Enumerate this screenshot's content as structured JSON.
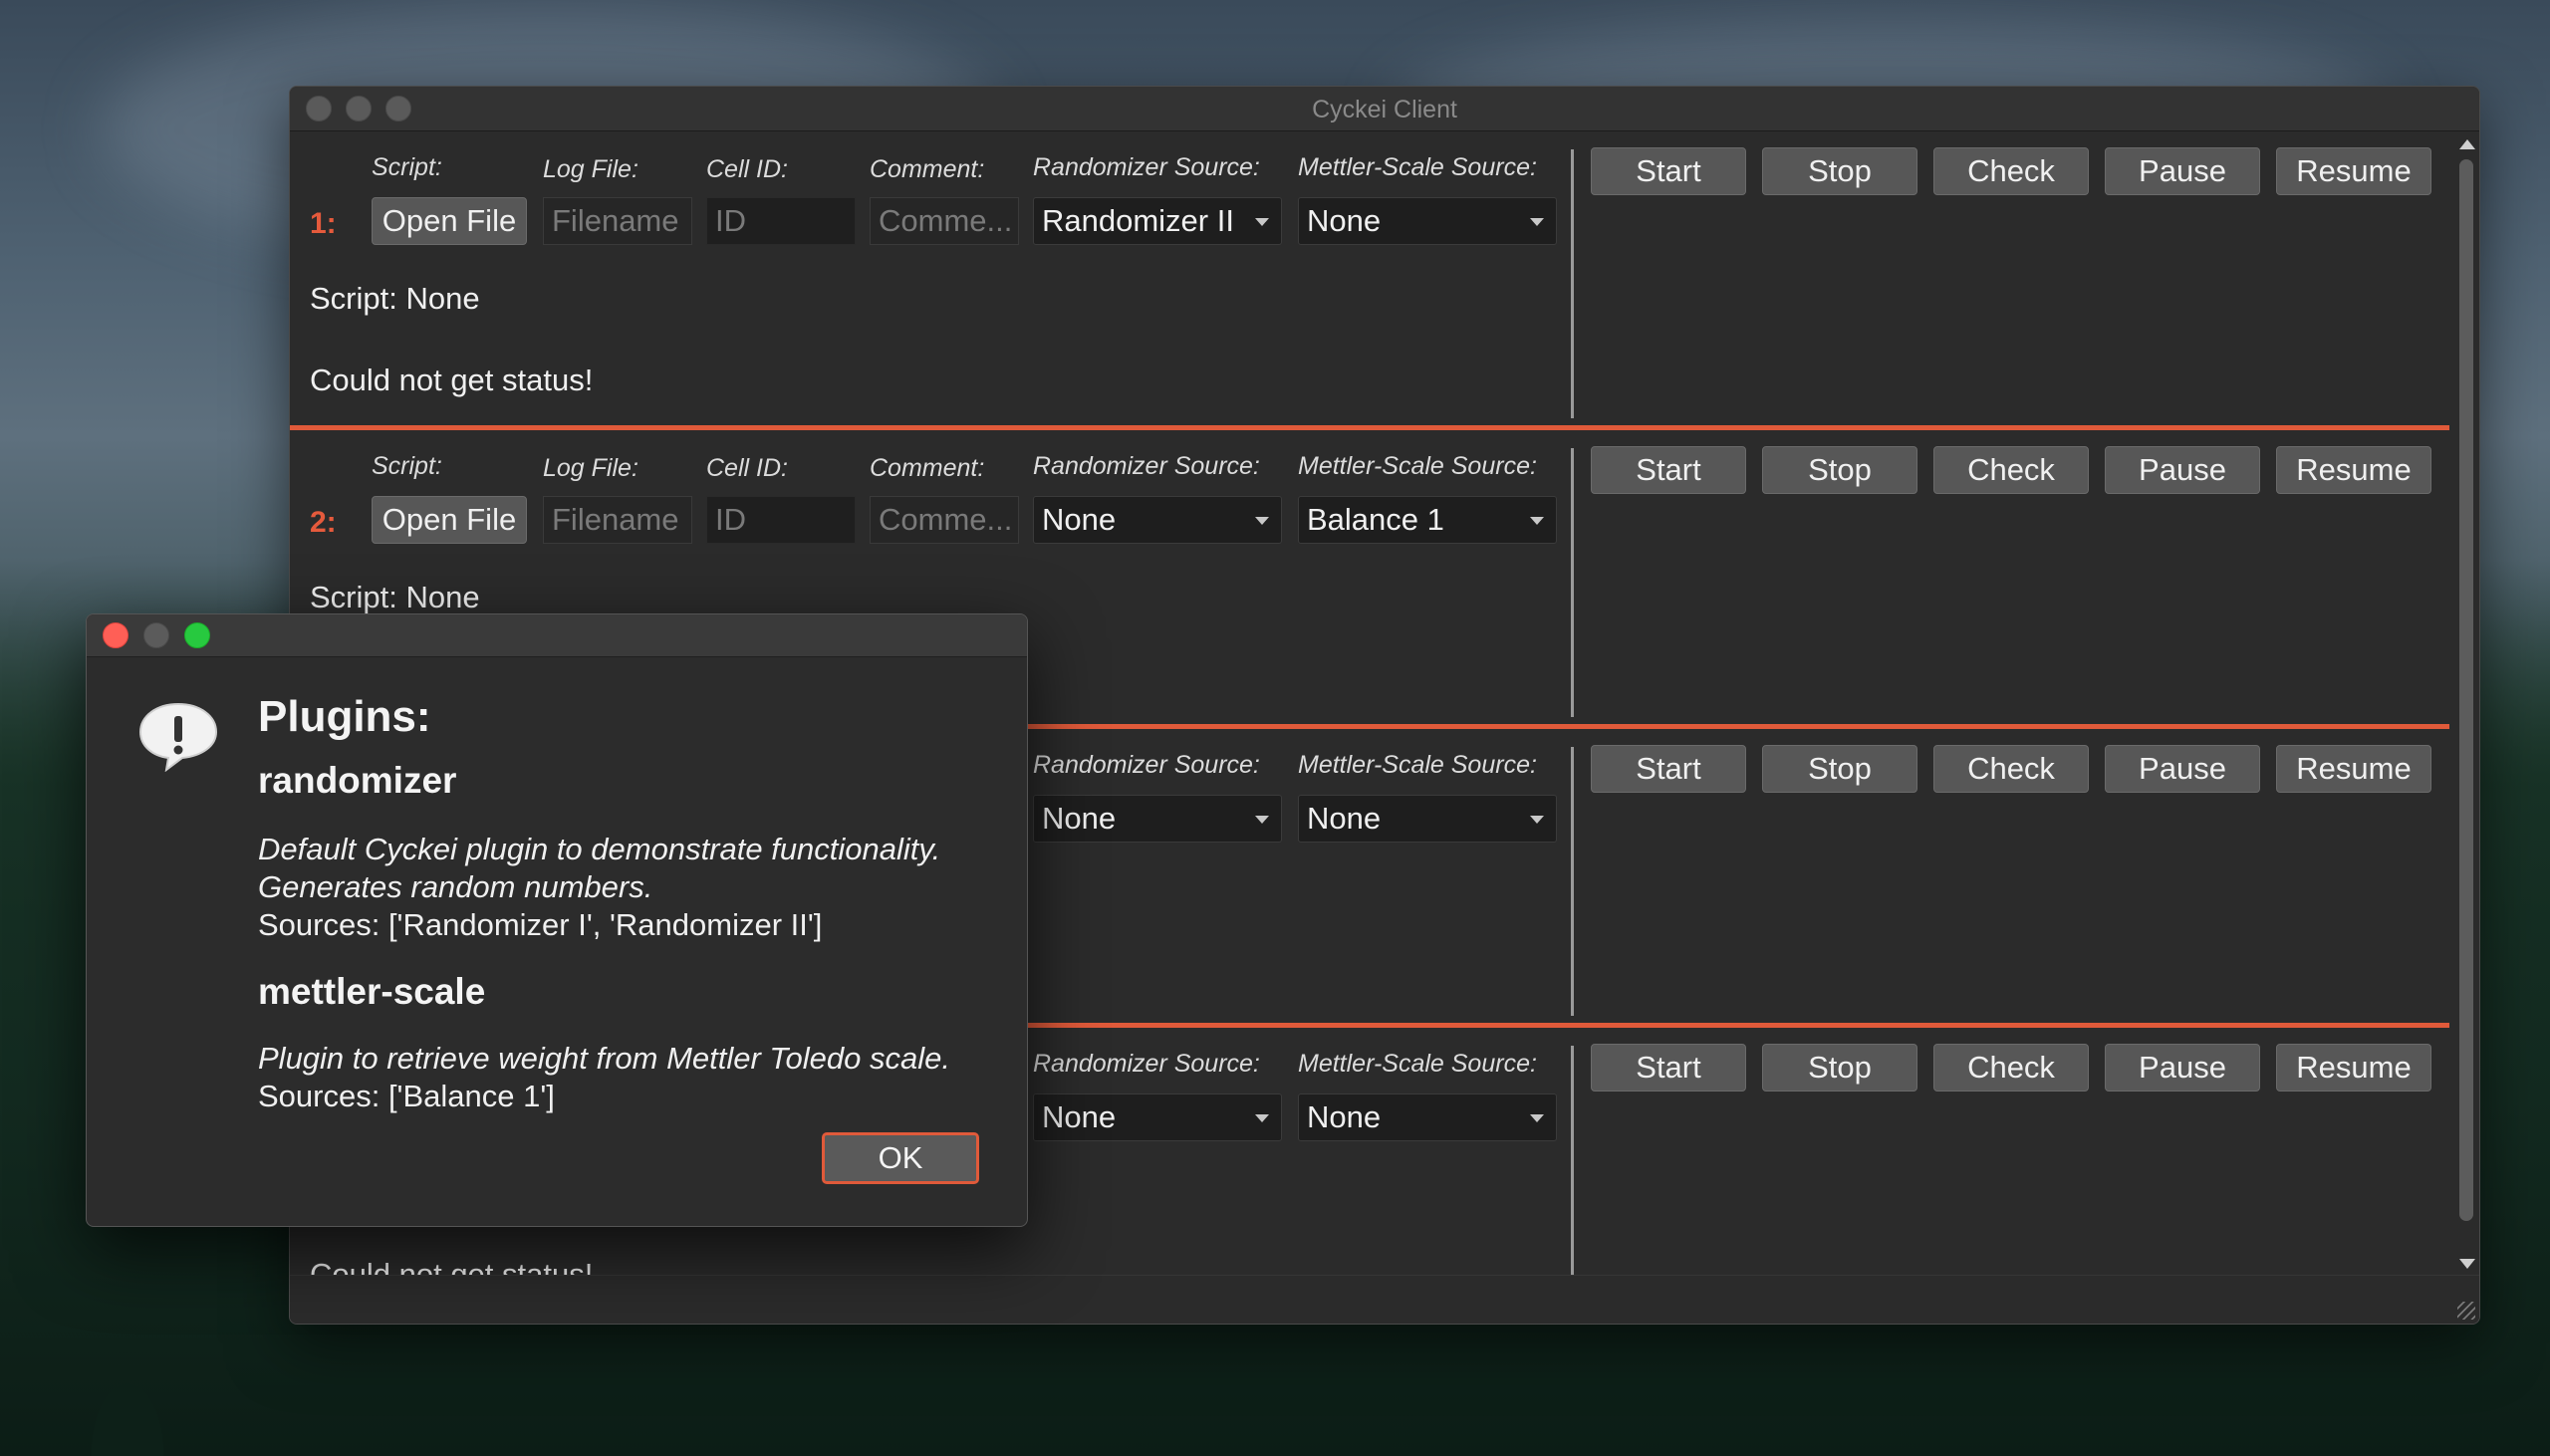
{
  "window": {
    "title": "Cyckei Client"
  },
  "labels": {
    "script": "Script:",
    "log_file": "Log File:",
    "cell_id": "Cell ID:",
    "comment": "Comment:",
    "randomizer_source": "Randomizer Source:",
    "mettler_source": "Mettler-Scale Source:"
  },
  "buttons": {
    "open_file": "Open File",
    "start": "Start",
    "stop": "Stop",
    "check": "Check",
    "pause": "Pause",
    "resume": "Resume"
  },
  "placeholders": {
    "filename": "Filename",
    "id": "ID",
    "comment": "Comme..."
  },
  "channels": [
    {
      "number": "1:",
      "randomizer": "Randomizer II",
      "mettler": "None",
      "script_status": "Script: None",
      "status": "Could not get status!"
    },
    {
      "number": "2:",
      "randomizer": "None",
      "mettler": "Balance 1",
      "script_status": "Script: None",
      "status": ""
    },
    {
      "number": "",
      "randomizer": "None",
      "mettler": "None",
      "script_status": "",
      "status": ""
    },
    {
      "number": "",
      "randomizer": "None",
      "mettler": "None",
      "script_status": "",
      "status": "Could not get status!"
    }
  ],
  "dialog": {
    "title": "Plugins:",
    "plugins": [
      {
        "name": "randomizer",
        "desc_line1": "Default Cyckei plugin to demonstrate functionality.",
        "desc_line2": "Generates random numbers.",
        "sources": "Sources: ['Randomizer I', 'Randomizer II']"
      },
      {
        "name": "mettler-scale",
        "desc_line1": "Plugin to retrieve weight from Mettler Toledo scale.",
        "sources": "Sources: ['Balance 1']"
      }
    ],
    "ok_label": "OK"
  },
  "colors": {
    "accent": "#e05a3a",
    "window_bg": "#2b2b2b"
  }
}
